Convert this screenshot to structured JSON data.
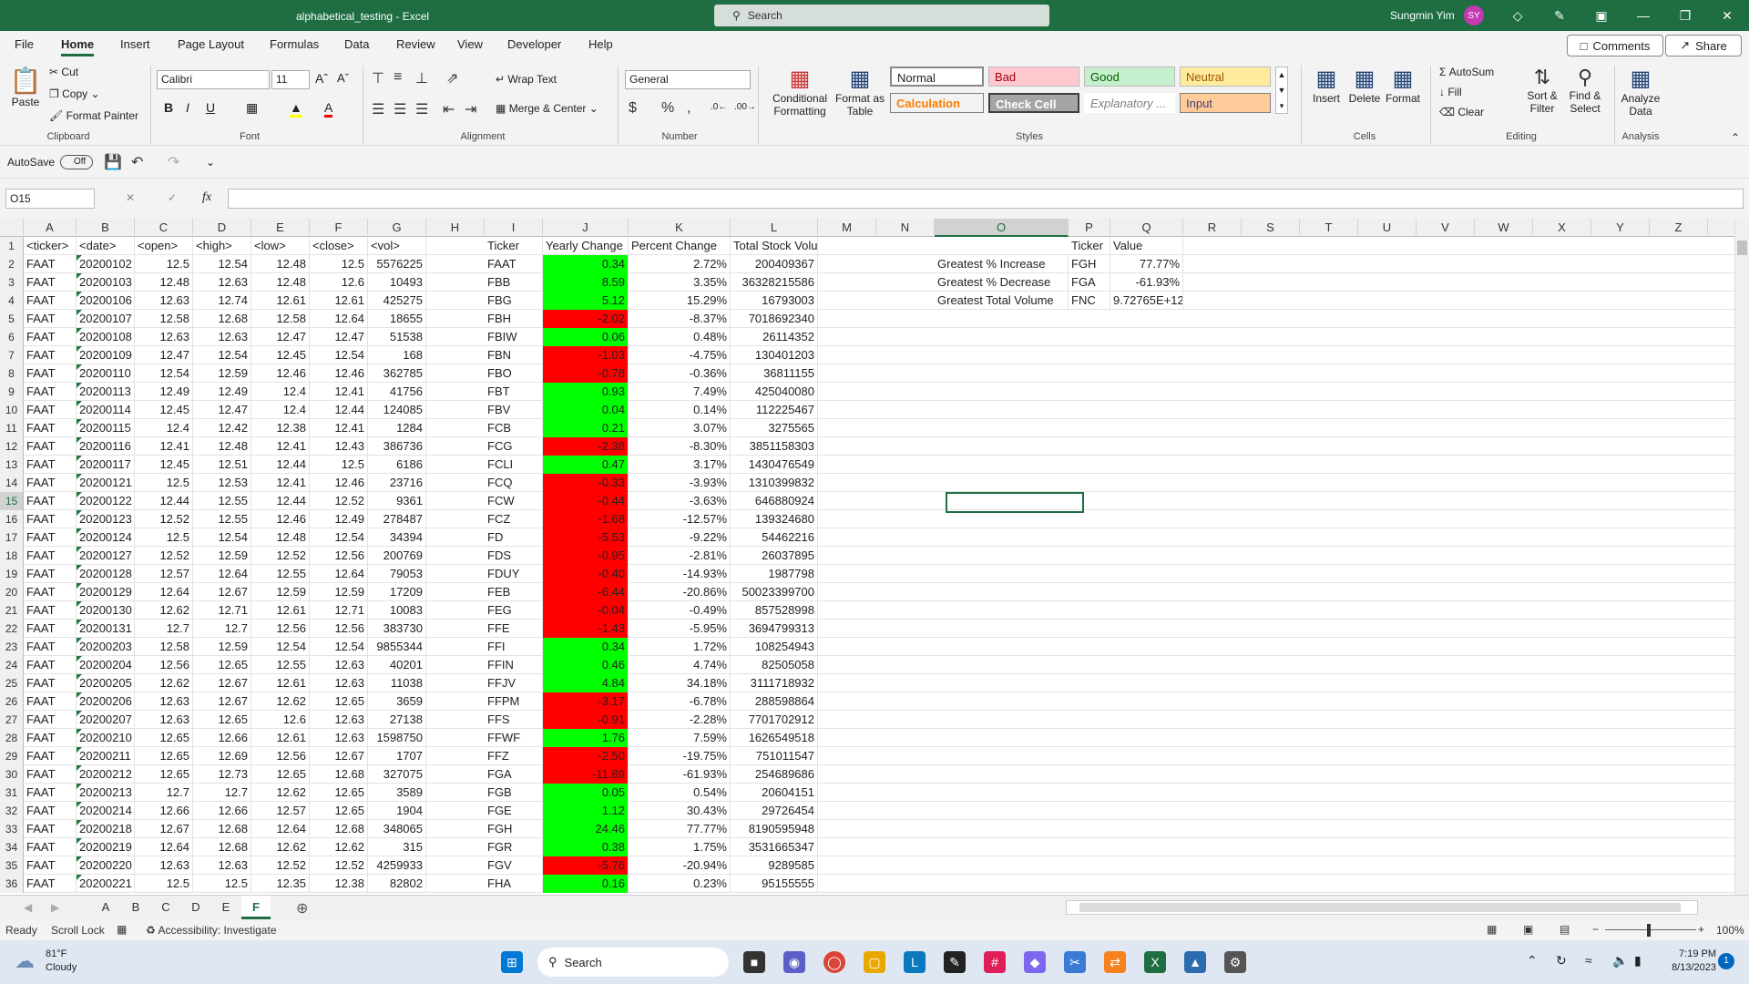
{
  "app": {
    "title": "alphabetical_testing  -  Excel",
    "search_placeholder": "Search",
    "user_name": "Sungmin Yim",
    "user_initials": "SY"
  },
  "menu": {
    "tabs": [
      "File",
      "Home",
      "Insert",
      "Page Layout",
      "Formulas",
      "Data",
      "Review",
      "View",
      "Developer",
      "Help"
    ],
    "comments": "Comments",
    "share": "Share"
  },
  "ribbon": {
    "clipboard": {
      "paste": "Paste",
      "cut": "Cut",
      "copy": "Copy",
      "format_painter": "Format Painter",
      "label": "Clipboard"
    },
    "font": {
      "name": "Calibri",
      "size": "11",
      "label": "Font"
    },
    "alignment": {
      "wrap": "Wrap Text",
      "merge": "Merge & Center",
      "label": "Alignment"
    },
    "number": {
      "format": "General",
      "label": "Number"
    },
    "styles": {
      "conditional": "Conditional Formatting",
      "format_table": "Format as Table",
      "normal": "Normal",
      "bad": "Bad",
      "good": "Good",
      "neutral": "Neutral",
      "calculation": "Calculation",
      "check_cell": "Check Cell",
      "explanatory": "Explanatory ...",
      "input": "Input",
      "label": "Styles"
    },
    "cells": {
      "insert": "Insert",
      "delete": "Delete",
      "format": "Format",
      "label": "Cells"
    },
    "editing": {
      "autosum": "AutoSum",
      "fill": "Fill",
      "clear": "Clear",
      "sort": "Sort & Filter",
      "find": "Find & Select",
      "label": "Editing"
    },
    "analysis": {
      "analyze": "Analyze Data",
      "label": "Analysis"
    }
  },
  "qat": {
    "autosave": "AutoSave",
    "toggle": "Off"
  },
  "formula_bar": {
    "name_box": "O15",
    "fx": "fx",
    "value": ""
  },
  "columns": [
    "A",
    "B",
    "C",
    "D",
    "E",
    "F",
    "G",
    "H",
    "I",
    "J",
    "K",
    "L",
    "M",
    "N",
    "O",
    "P",
    "Q",
    "R",
    "S",
    "T",
    "U",
    "V",
    "W",
    "X",
    "Y",
    "Z"
  ],
  "selected": {
    "col": "O",
    "row": "15"
  },
  "sheet": {
    "header": [
      "<ticker>",
      "<date>",
      "<open>",
      "<high>",
      "<low>",
      "<close>",
      "<vol>"
    ],
    "summary_header": [
      "Ticker",
      "Yearly Change",
      "Percent Change",
      "Total Stock Volume"
    ],
    "raw": [
      [
        "FAAT",
        "20200102",
        "12.5",
        "12.54",
        "12.48",
        "12.5",
        "5576225"
      ],
      [
        "FAAT",
        "20200103",
        "12.48",
        "12.63",
        "12.48",
        "12.6",
        "10493"
      ],
      [
        "FAAT",
        "20200106",
        "12.63",
        "12.74",
        "12.61",
        "12.61",
        "425275"
      ],
      [
        "FAAT",
        "20200107",
        "12.58",
        "12.68",
        "12.58",
        "12.64",
        "18655"
      ],
      [
        "FAAT",
        "20200108",
        "12.63",
        "12.63",
        "12.47",
        "12.47",
        "51538"
      ],
      [
        "FAAT",
        "20200109",
        "12.47",
        "12.54",
        "12.45",
        "12.54",
        "168"
      ],
      [
        "FAAT",
        "20200110",
        "12.54",
        "12.59",
        "12.46",
        "12.46",
        "362785"
      ],
      [
        "FAAT",
        "20200113",
        "12.49",
        "12.49",
        "12.4",
        "12.41",
        "41756"
      ],
      [
        "FAAT",
        "20200114",
        "12.45",
        "12.47",
        "12.4",
        "12.44",
        "124085"
      ],
      [
        "FAAT",
        "20200115",
        "12.4",
        "12.42",
        "12.38",
        "12.41",
        "1284"
      ],
      [
        "FAAT",
        "20200116",
        "12.41",
        "12.48",
        "12.41",
        "12.43",
        "386736"
      ],
      [
        "FAAT",
        "20200117",
        "12.45",
        "12.51",
        "12.44",
        "12.5",
        "6186"
      ],
      [
        "FAAT",
        "20200121",
        "12.5",
        "12.53",
        "12.41",
        "12.46",
        "23716"
      ],
      [
        "FAAT",
        "20200122",
        "12.44",
        "12.55",
        "12.44",
        "12.52",
        "9361"
      ],
      [
        "FAAT",
        "20200123",
        "12.52",
        "12.55",
        "12.46",
        "12.49",
        "278487"
      ],
      [
        "FAAT",
        "20200124",
        "12.5",
        "12.54",
        "12.48",
        "12.54",
        "34394"
      ],
      [
        "FAAT",
        "20200127",
        "12.52",
        "12.59",
        "12.52",
        "12.56",
        "200769"
      ],
      [
        "FAAT",
        "20200128",
        "12.57",
        "12.64",
        "12.55",
        "12.64",
        "79053"
      ],
      [
        "FAAT",
        "20200129",
        "12.64",
        "12.67",
        "12.59",
        "12.59",
        "17209"
      ],
      [
        "FAAT",
        "20200130",
        "12.62",
        "12.71",
        "12.61",
        "12.71",
        "10083"
      ],
      [
        "FAAT",
        "20200131",
        "12.7",
        "12.7",
        "12.56",
        "12.56",
        "383730"
      ],
      [
        "FAAT",
        "20200203",
        "12.58",
        "12.59",
        "12.54",
        "12.54",
        "9855344"
      ],
      [
        "FAAT",
        "20200204",
        "12.56",
        "12.65",
        "12.55",
        "12.63",
        "40201"
      ],
      [
        "FAAT",
        "20200205",
        "12.62",
        "12.67",
        "12.61",
        "12.63",
        "11038"
      ],
      [
        "FAAT",
        "20200206",
        "12.63",
        "12.67",
        "12.62",
        "12.65",
        "3659"
      ],
      [
        "FAAT",
        "20200207",
        "12.63",
        "12.65",
        "12.6",
        "12.63",
        "27138"
      ],
      [
        "FAAT",
        "20200210",
        "12.65",
        "12.66",
        "12.61",
        "12.63",
        "1598750"
      ],
      [
        "FAAT",
        "20200211",
        "12.65",
        "12.69",
        "12.56",
        "12.67",
        "1707"
      ],
      [
        "FAAT",
        "20200212",
        "12.65",
        "12.73",
        "12.65",
        "12.68",
        "327075"
      ],
      [
        "FAAT",
        "20200213",
        "12.7",
        "12.7",
        "12.62",
        "12.65",
        "3589"
      ],
      [
        "FAAT",
        "20200214",
        "12.66",
        "12.66",
        "12.57",
        "12.65",
        "1904"
      ],
      [
        "FAAT",
        "20200218",
        "12.67",
        "12.68",
        "12.64",
        "12.68",
        "348065"
      ],
      [
        "FAAT",
        "20200219",
        "12.64",
        "12.68",
        "12.62",
        "12.62",
        "315"
      ],
      [
        "FAAT",
        "20200220",
        "12.63",
        "12.63",
        "12.52",
        "12.52",
        "4259933"
      ],
      [
        "FAAT",
        "20200221",
        "12.5",
        "12.5",
        "12.35",
        "12.38",
        "82802"
      ]
    ],
    "summary": [
      [
        "FAAT",
        "0.34",
        "2.72%",
        "200409367"
      ],
      [
        "FBB",
        "8.59",
        "3.35%",
        "36328215586"
      ],
      [
        "FBG",
        "5.12",
        "15.29%",
        "16793003"
      ],
      [
        "FBH",
        "-2.02",
        "-8.37%",
        "7018692340"
      ],
      [
        "FBIW",
        "0.06",
        "0.48%",
        "26114352"
      ],
      [
        "FBN",
        "-1.03",
        "-4.75%",
        "130401203"
      ],
      [
        "FBO",
        "-0.78",
        "-0.36%",
        "36811155"
      ],
      [
        "FBT",
        "0.93",
        "7.49%",
        "425040080"
      ],
      [
        "FBV",
        "0.04",
        "0.14%",
        "112225467"
      ],
      [
        "FCB",
        "0.21",
        "3.07%",
        "3275565"
      ],
      [
        "FCG",
        "-2.38",
        "-8.30%",
        "3851158303"
      ],
      [
        "FCLI",
        "0.47",
        "3.17%",
        "1430476549"
      ],
      [
        "FCQ",
        "-0.33",
        "-3.93%",
        "1310399832"
      ],
      [
        "FCW",
        "-0.44",
        "-3.63%",
        "646880924"
      ],
      [
        "FCZ",
        "-1.68",
        "-12.57%",
        "139324680"
      ],
      [
        "FD",
        "-5.53",
        "-9.22%",
        "54462216"
      ],
      [
        "FDS",
        "-0.95",
        "-2.81%",
        "26037895"
      ],
      [
        "FDUY",
        "-0.40",
        "-14.93%",
        "1987798"
      ],
      [
        "FEB",
        "-6.44",
        "-20.86%",
        "50023399700"
      ],
      [
        "FEG",
        "-0.04",
        "-0.49%",
        "857528998"
      ],
      [
        "FFE",
        "-1.43",
        "-5.95%",
        "3694799313"
      ],
      [
        "FFI",
        "0.34",
        "1.72%",
        "108254943"
      ],
      [
        "FFIN",
        "0.46",
        "4.74%",
        "82505058"
      ],
      [
        "FFJV",
        "4.84",
        "34.18%",
        "3111718932"
      ],
      [
        "FFPM",
        "-3.17",
        "-6.78%",
        "288598864"
      ],
      [
        "FFS",
        "-0.91",
        "-2.28%",
        "7701702912"
      ],
      [
        "FFWF",
        "1.76",
        "7.59%",
        "1626549518"
      ],
      [
        "FFZ",
        "-2.50",
        "-19.75%",
        "751011547"
      ],
      [
        "FGA",
        "-11.89",
        "-61.93%",
        "254689686"
      ],
      [
        "FGB",
        "0.05",
        "0.54%",
        "20604151"
      ],
      [
        "FGE",
        "1.12",
        "30.43%",
        "29726454"
      ],
      [
        "FGH",
        "24.46",
        "77.77%",
        "8190595948"
      ],
      [
        "FGR",
        "0.38",
        "1.75%",
        "3531665347"
      ],
      [
        "FGV",
        "-5.76",
        "-20.94%",
        "9289585"
      ],
      [
        "FHA",
        "0.16",
        "0.23%",
        "95155555"
      ]
    ],
    "greatest_header": [
      "Ticker",
      "Value"
    ],
    "greatest": [
      [
        "Greatest % Increase",
        "FGH",
        "77.77%"
      ],
      [
        "Greatest % Decrease",
        "FGA",
        "-61.93%"
      ],
      [
        "Greatest Total Volume",
        "FNC",
        "9.72765E+12"
      ]
    ]
  },
  "sheet_tabs": [
    "A",
    "B",
    "C",
    "D",
    "E",
    "F"
  ],
  "active_tab": "F",
  "status": {
    "ready": "Ready",
    "scroll_lock": "Scroll Lock",
    "accessibility": "Accessibility: Investigate",
    "zoom": "100%"
  },
  "taskbar": {
    "temp": "81°F",
    "weather": "Cloudy",
    "search": "Search",
    "time": "7:19 PM",
    "date": "8/13/2023",
    "badge": "1"
  },
  "colors": {
    "accent": "#1e6e42",
    "positive": "#00ff00",
    "negative": "#ff0000"
  }
}
